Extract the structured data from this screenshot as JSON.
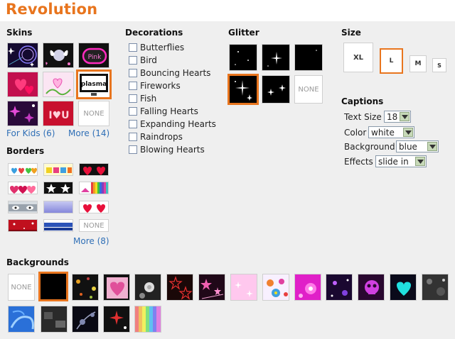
{
  "app": {
    "title": "Revolution"
  },
  "skins": {
    "heading": "Skins",
    "items": [
      {
        "name": "stars-skin"
      },
      {
        "name": "butterfly-skin"
      },
      {
        "name": "pink-skin",
        "text": "Pink"
      },
      {
        "name": "hearts-skin"
      },
      {
        "name": "heart-swirl-skin"
      },
      {
        "name": "plasma-skin",
        "text": "plasma"
      },
      {
        "name": "sparkle-skin"
      },
      {
        "name": "iloveu-skin",
        "text": "I♥U"
      },
      {
        "name": "none-skin",
        "text": "NONE"
      }
    ],
    "for_kids_link": "For Kids (6)",
    "more_link": "More (14)"
  },
  "borders": {
    "heading": "Borders",
    "none_text": "NONE",
    "more_link": "More (8)"
  },
  "decorations": {
    "heading": "Decorations",
    "items": [
      {
        "label": "Butterflies"
      },
      {
        "label": "Bird"
      },
      {
        "label": "Bouncing Hearts"
      },
      {
        "label": "Fireworks"
      },
      {
        "label": "Fish"
      },
      {
        "label": "Falling Hearts"
      },
      {
        "label": "Expanding Hearts"
      },
      {
        "label": "Raindrops"
      },
      {
        "label": "Blowing Hearts"
      }
    ]
  },
  "glitter": {
    "heading": "Glitter",
    "none_text": "NONE"
  },
  "size": {
    "heading": "Size",
    "options": [
      "XL",
      "L",
      "M",
      "S"
    ],
    "selected": "L"
  },
  "captions": {
    "heading": "Captions",
    "text_size": {
      "label": "Text Size",
      "value": "18"
    },
    "color": {
      "label": "Color",
      "value": "white"
    },
    "background": {
      "label": "Background",
      "value": "blue"
    },
    "effects": {
      "label": "Effects",
      "value": "slide in"
    }
  },
  "backgrounds": {
    "heading": "Backgrounds",
    "none_text": "NONE"
  },
  "colors": {
    "accent": "#e8751e",
    "link": "#2f6fb6",
    "panel": "#efefef"
  }
}
